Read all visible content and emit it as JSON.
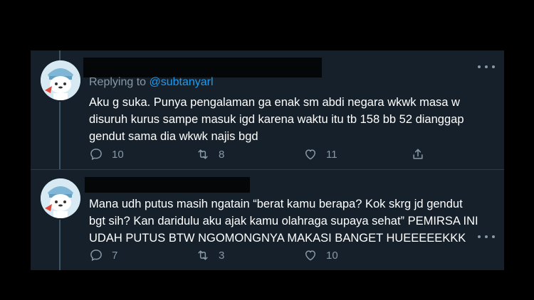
{
  "tweets": [
    {
      "reply_prefix": "Replying to",
      "reply_handle": "@subtanyarl",
      "text": "Aku g suka. Punya pengalaman ga enak sm abdi negara wkwk masa w\ndisuruh kurus sampe masuk igd karena waktu itu tb 158 bb 52 dianggap\ngendut sama dia wkwk najis bgd",
      "replies": "10",
      "retweets": "8",
      "likes": "11"
    },
    {
      "text": "Mana udh putus masih ngatain “berat kamu berapa? Kok skrg jd gendut\nbgt sih? Kan daridulu aku ajak kamu olahraga supaya sehat” PEMIRSA INI\nUDAH PUTUS BTW NGOMONGNYA MAKASI BANGET HUEEEEEKKK",
      "replies": "7",
      "retweets": "3",
      "likes": "10"
    }
  ],
  "icons": {
    "reply": "reply-icon",
    "retweet": "retweet-icon",
    "like": "heart-icon",
    "share": "share-icon",
    "more": "more-options-icon"
  },
  "colors": {
    "card_bg": "#15202b",
    "text": "#ffffff",
    "muted": "#8899a6",
    "link": "#1d9bf0"
  }
}
